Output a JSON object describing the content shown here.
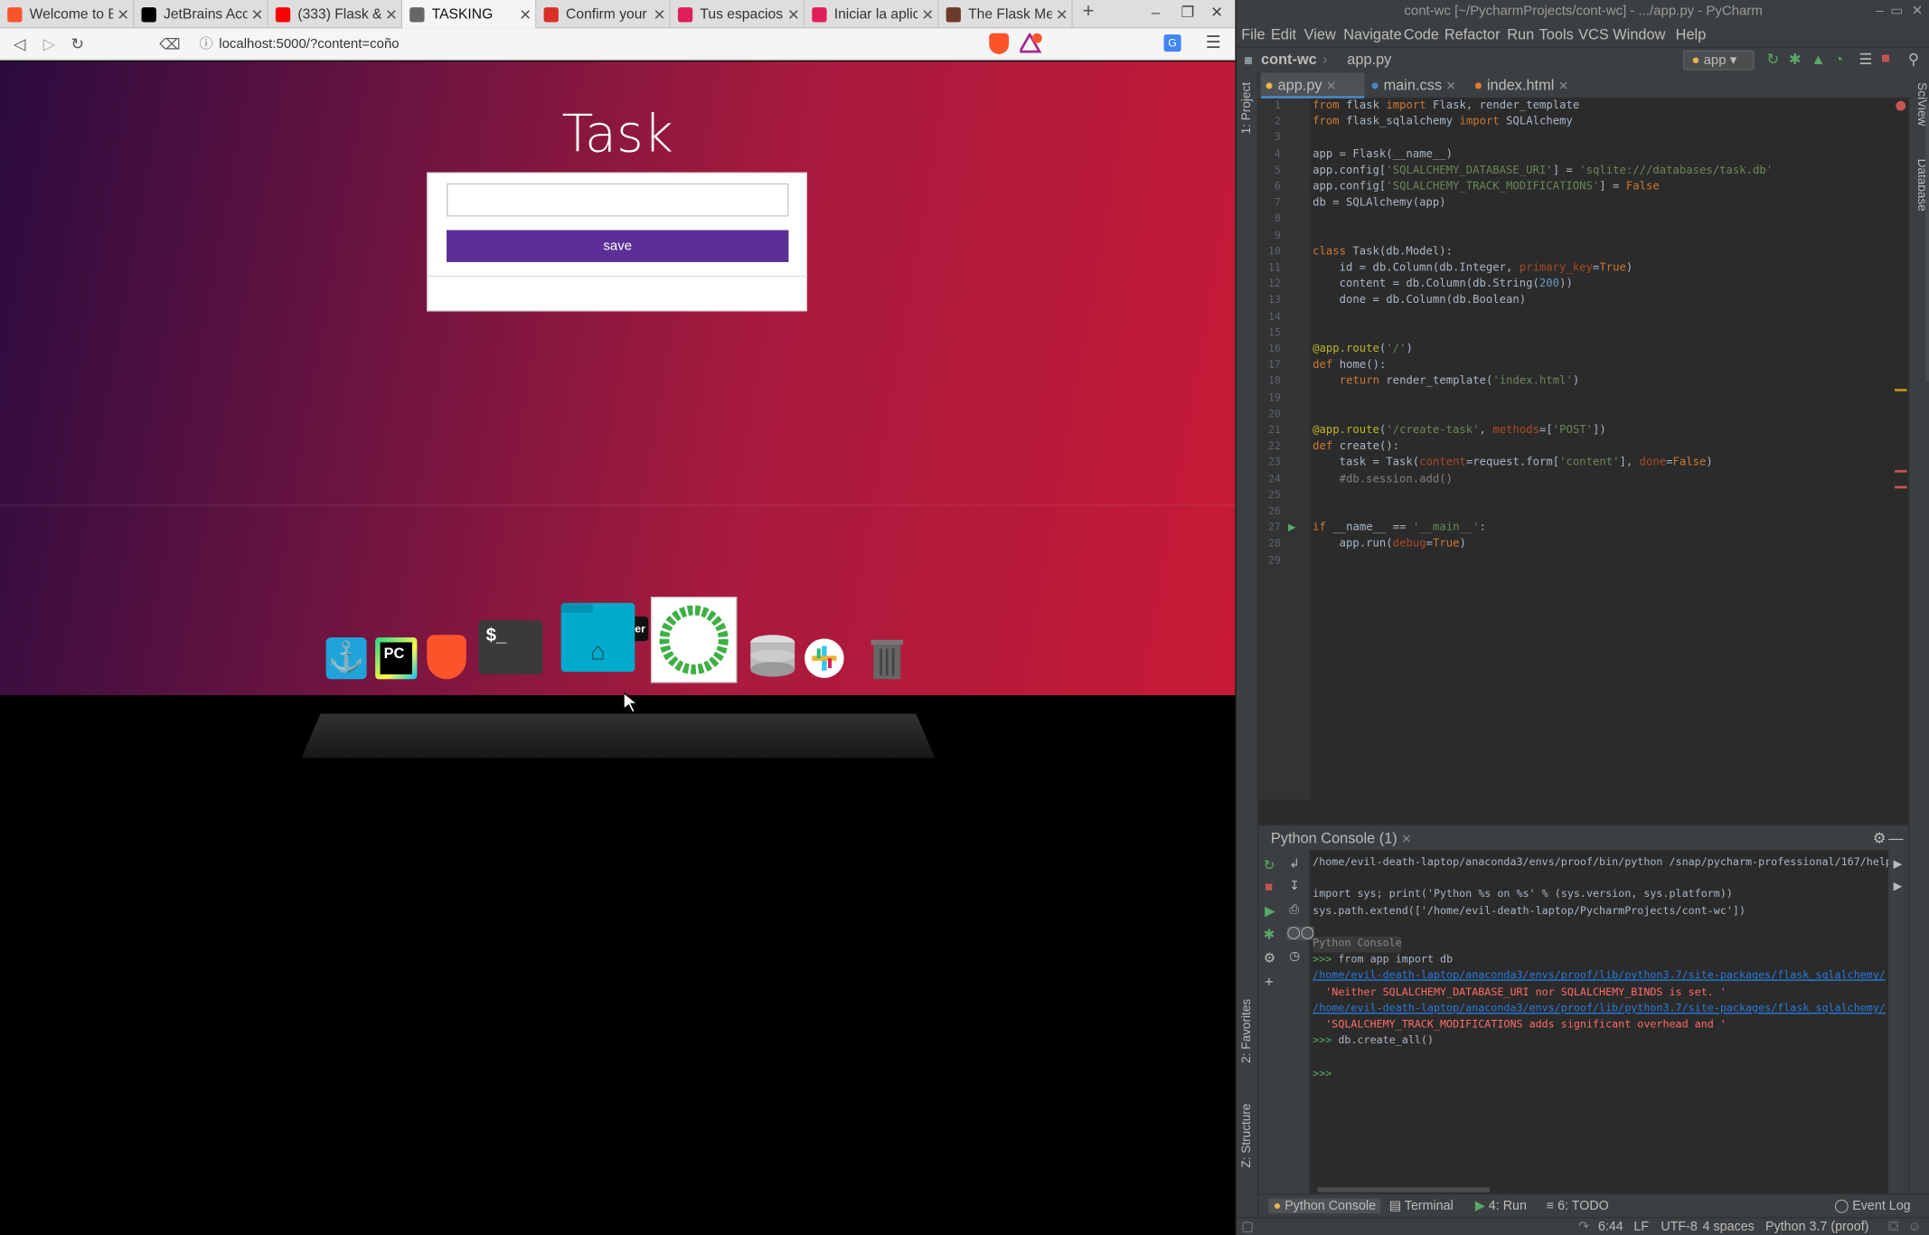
{
  "browser": {
    "tabs": [
      {
        "label": "Welcome to B",
        "icon": "brave-icon",
        "color": "#fb542b"
      },
      {
        "label": "JetBrains Acc",
        "icon": "jetbrains-icon",
        "color": "#000000"
      },
      {
        "label": "(333) Flask &",
        "icon": "youtube-icon",
        "color": "#ff0000"
      },
      {
        "label": "TASKING",
        "icon": "globe-icon",
        "color": "#666666"
      },
      {
        "label": "Confirm your",
        "icon": "gmail-icon",
        "color": "#d93025"
      },
      {
        "label": "Tus espacios",
        "icon": "slack-icon",
        "color": "#e01e5a"
      },
      {
        "label": "Iniciar la aplic",
        "icon": "slack-icon",
        "color": "#e01e5a"
      },
      {
        "label": "The Flask Me",
        "icon": "avatar-icon",
        "color": "#6b3a2a"
      }
    ],
    "new_tab": "+",
    "url": "localhost:5000/?content=coño",
    "shield_badge": "1"
  },
  "webapp": {
    "title": "Task",
    "input_value": "",
    "save_label": "save"
  },
  "dock": {
    "tooltip": "Home Folder",
    "items": [
      "anchor-app-icon",
      "pycharm-icon",
      "brave-icon",
      "terminal-icon",
      "home-folder-icon",
      "ring-app-icon",
      "database-icon",
      "slack-icon",
      "trash-icon"
    ],
    "terminal_glyph": "$_"
  },
  "pycharm": {
    "window_title": "cont-wc [~/PycharmProjects/cont-wc] - .../app.py - PyCharm",
    "menu": [
      "File",
      "Edit",
      "View",
      "Navigate",
      "Code",
      "Refactor",
      "Run",
      "Tools",
      "VCS",
      "Window",
      "Help"
    ],
    "breadcrumb": [
      "cont-wc",
      "app.py"
    ],
    "run_config": "app",
    "tabs": [
      "app.py",
      "main.css",
      "index.html"
    ],
    "left_tool_windows": [
      "1: Project",
      "2: Favorites",
      "Z: Structure"
    ],
    "right_tool_windows": [
      "SciView",
      "Database"
    ],
    "console_title": "Python Console (1)",
    "console_lines": [
      "/home/evil-death-laptop/anaconda3/envs/proof/bin/python /snap/pycharm-professional/167/help",
      "",
      "import sys; print('Python %s on %s' % (sys.version, sys.platform))",
      "sys.path.extend(['/home/evil-death-laptop/PycharmProjects/cont-wc'])",
      "",
      "Python Console",
      ">>> from app import db",
      "/home/evil-death-laptop/anaconda3/envs/proof/lib/python3.7/site-packages/flask_sqlalchemy/",
      "  'Neither SQLALCHEMY_DATABASE_URI nor SQLALCHEMY_BINDS is set. '",
      "/home/evil-death-laptop/anaconda3/envs/proof/lib/python3.7/site-packages/flask_sqlalchemy/",
      "  'SQLALCHEMY_TRACK_MODIFICATIONS adds significant overhead and '",
      ">>> db.create_all()",
      "",
      ">>>"
    ],
    "bottom_tabs": [
      "Python Console",
      "Terminal",
      "4: Run",
      "6: TODO"
    ],
    "event_log": "Event Log",
    "status": {
      "position": "6:44",
      "line_sep": "LF",
      "encoding": "UTF-8",
      "indent": "4 spaces",
      "interpreter": "Python 3.7 (proof)"
    }
  },
  "code": {
    "line_numbers": [
      "1",
      "2",
      "3",
      "4",
      "5",
      "6",
      "7",
      "8",
      "9",
      "10",
      "11",
      "12",
      "13",
      "14",
      "15",
      "16",
      "17",
      "18",
      "19",
      "20",
      "21",
      "22",
      "23",
      "24",
      "25",
      "26",
      "27",
      "28",
      "29"
    ],
    "lines": [
      "from flask import Flask, render_template",
      "from flask_sqlalchemy import SQLAlchemy",
      "",
      "app = Flask(__name__)",
      "app.config['SQLALCHEMY_DATABASE_URI'] = 'sqlite:///databases/task.db'",
      "app.config['SQLALCHEMY_TRACK_MODIFICATIONS'] = False",
      "db = SQLAlchemy(app)",
      "",
      "",
      "class Task(db.Model):",
      "    id = db.Column(db.Integer, primary_key=True)",
      "    content = db.Column(db.String(200))",
      "    done = db.Column(db.Boolean)",
      "",
      "",
      "@app.route('/')",
      "def home():",
      "    return render_template('index.html')",
      "",
      "",
      "@app.route('/create-task', methods=['POST'])",
      "def create():",
      "    task = Task(content=request.form['content'], done=False)",
      "    #db.session.add()",
      "",
      "",
      "if __name__ == '__main__':",
      "    app.run(debug=True)",
      ""
    ]
  },
  "colors": {
    "accent": "#5b2f96",
    "ide_bg": "#2b2b2b",
    "keyword": "#cc7832",
    "string": "#6a8759"
  }
}
